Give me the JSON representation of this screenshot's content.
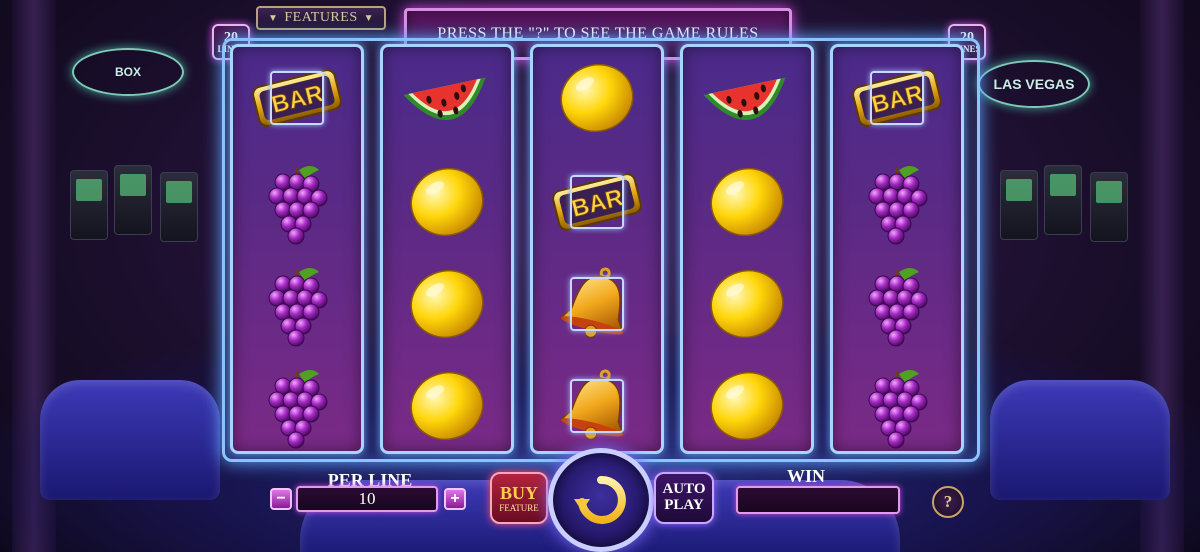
{
  "header": {
    "features_label": "FEATURES",
    "rules_message": "PRESS THE \"?\" TO SEE THE GAME RULES",
    "lines_badge_left": {
      "number": "20",
      "label": "LINES"
    },
    "lines_badge_right": {
      "number": "20",
      "label": "LINES"
    }
  },
  "background": {
    "sign_left": "BOX",
    "sign_right": "LAS VEGAS"
  },
  "reels": [
    [
      "bar",
      "grapes",
      "grapes",
      "grapes"
    ],
    [
      "watermelon",
      "lemon",
      "lemon",
      "lemon"
    ],
    [
      "lemon",
      "bar",
      "bell",
      "bell"
    ],
    [
      "watermelon",
      "lemon",
      "lemon",
      "lemon"
    ],
    [
      "bar",
      "grapes",
      "grapes",
      "grapes"
    ]
  ],
  "symbol_labels": {
    "bar": "BAR"
  },
  "controls": {
    "per_line_label": "PER LINE",
    "per_line_value": "10",
    "minus_label": "−",
    "plus_label": "+",
    "buy_label": "BUY",
    "buy_sub": "FEATURE",
    "auto_label_1": "AUTO",
    "auto_label_2": "PLAY",
    "win_label": "WIN",
    "win_value": "",
    "help_label": "?"
  },
  "colors": {
    "accent_pink": "#d24bdf",
    "frame_blue": "#8ec4ff",
    "gold": "#ffd24a"
  }
}
